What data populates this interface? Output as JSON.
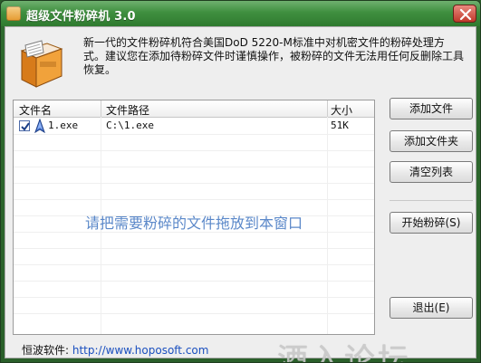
{
  "window": {
    "title": "超级文件粉碎机  3.0"
  },
  "description": {
    "text": "新一代的文件粉碎机符合美国DoD 5220-M标准中对机密文件的粉碎处理方式。建议您在添加待粉碎文件时谨慎操作，被粉碎的文件无法用任何反删除工具恢复。"
  },
  "list": {
    "headers": {
      "name": "文件名",
      "path": "文件路径",
      "size": "大小"
    },
    "rows": [
      {
        "checked": true,
        "name": "1.exe",
        "path": "C:\\1.exe",
        "size": "51K"
      }
    ],
    "drop_hint": "请把需要粉碎的文件拖放到本窗口"
  },
  "buttons": {
    "add_file": "添加文件",
    "add_folder": "添加文件夹",
    "clear_list": "清空列表",
    "start_shred": "开始粉碎(S)",
    "exit": "退出(E)"
  },
  "status": {
    "label": "恒波软件:",
    "url": "http://www.hoposoft.com"
  },
  "watermark": {
    "text": "酒入论坛"
  },
  "icons": {
    "app": "app-icon",
    "close": "close-icon",
    "logo": "shredder-logo-icon",
    "check": "check-icon",
    "file": "file-exe-icon"
  },
  "colors": {
    "frame": "#2f6b2f",
    "link": "#1a4fbf",
    "hint": "#5b88c9"
  }
}
